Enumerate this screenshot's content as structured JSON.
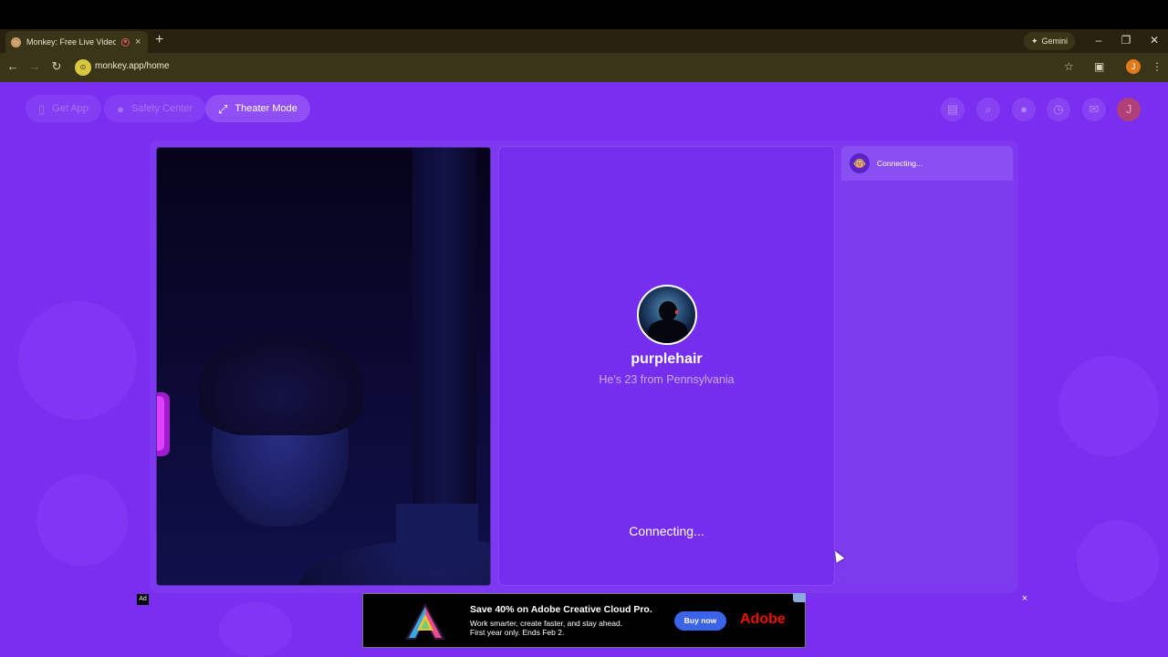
{
  "browser": {
    "tab_title": "Monkey: Free Live Video Chat",
    "new_tab_icon": "plus-icon",
    "gemini_label": "Gemini",
    "url": "monkey.app/home",
    "profile_initial": "J"
  },
  "header": {
    "get_app": "Get App",
    "safety_center": "Safety Center",
    "theater_mode": "Theater Mode",
    "icons": [
      "shop-icon",
      "search-icon",
      "profile-icon",
      "history-icon",
      "chat-icon"
    ],
    "user_initial": "J"
  },
  "partner": {
    "name": "purplehair",
    "info": "He's 23 from Pennsylvania",
    "status": "Connecting..."
  },
  "chat": {
    "status": "Connecting..."
  },
  "ad": {
    "label": "Ad",
    "headline": "Save 40% on Adobe Creative Cloud Pro.",
    "line1": "Work smarter, create faster, and stay ahead.",
    "line2": "First year only. Ends Feb 2.",
    "cta": "Buy now",
    "brand": "Adobe",
    "close": "×"
  },
  "colors": {
    "page_bg": "#7a2ff0",
    "accent": "#3b63e8",
    "brand_red": "#eb1000",
    "browser_frame": "#3a3519"
  }
}
